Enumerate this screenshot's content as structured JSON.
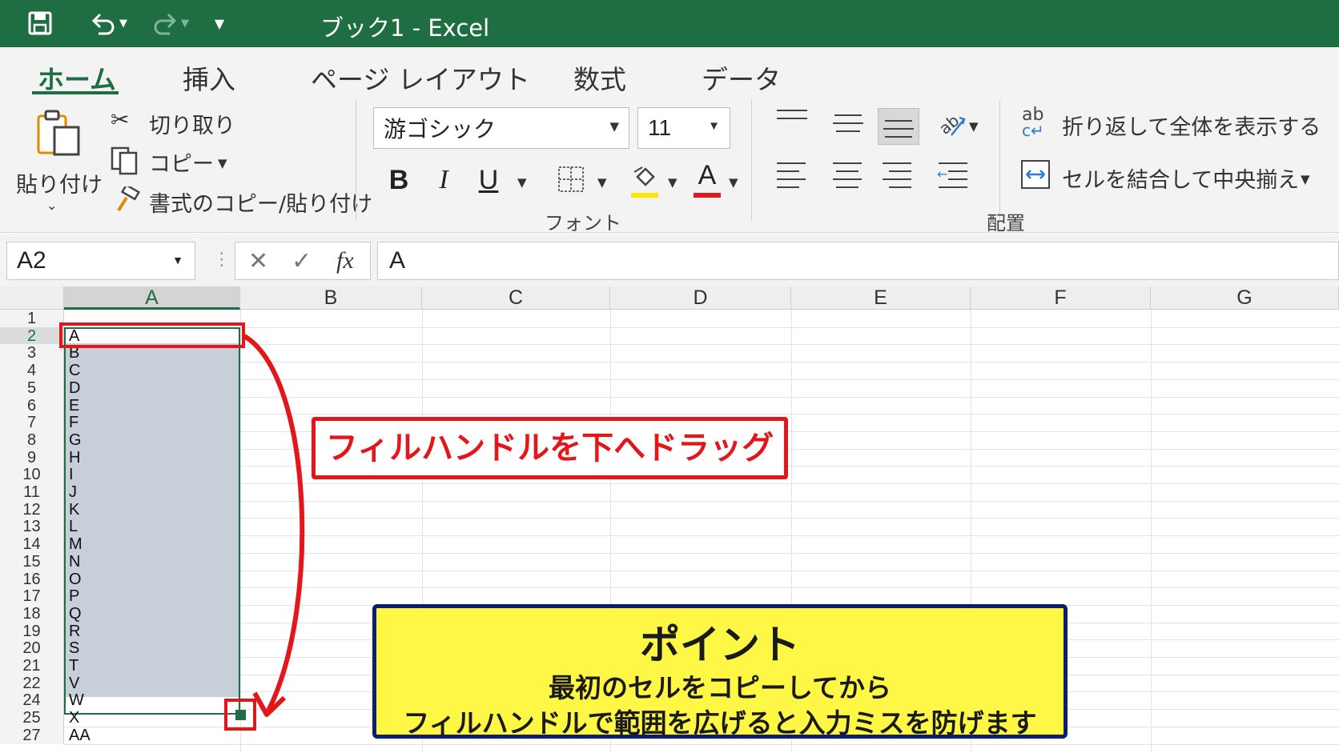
{
  "titlebar": {
    "title": "ブック1 - Excel",
    "icons": [
      "save-icon",
      "undo-icon",
      "redo-icon",
      "customize-quick-access-icon"
    ]
  },
  "ribbon": {
    "tabs": [
      "ホーム",
      "挿入",
      "ページ レイアウト",
      "数式",
      "データ"
    ],
    "active_tab": "ホーム",
    "clipboard": {
      "paste": "貼り付け",
      "cut": "切り取り",
      "copy": "コピー",
      "format_painter": "書式のコピー/貼り付け"
    },
    "font": {
      "font_name": "游ゴシック",
      "font_size": "11",
      "bold": "B",
      "italic": "I",
      "underline": "U",
      "font_color_letter": "A",
      "group_label": "フォント",
      "highlight_color": "#ffe500",
      "font_color": "#e3161a"
    },
    "alignment": {
      "wrap_text": "折り返して全体を表示する",
      "merge_center": "セルを結合して中央揃え",
      "wrap_icon_text": "ab",
      "group_label": "配置"
    }
  },
  "formula_bar": {
    "name_box": "A2",
    "cancel": "✕",
    "enter": "✓",
    "fx": "fx",
    "value": "A"
  },
  "sheet": {
    "columns": [
      "A",
      "B",
      "C",
      "D",
      "E",
      "F",
      "G"
    ],
    "selected_column": "A",
    "selected_row": "2",
    "rows": [
      {
        "num": "1",
        "a": ""
      },
      {
        "num": "2",
        "a": "A"
      },
      {
        "num": "3",
        "a": "B"
      },
      {
        "num": "4",
        "a": "C"
      },
      {
        "num": "5",
        "a": "D"
      },
      {
        "num": "6",
        "a": "E"
      },
      {
        "num": "7",
        "a": "F"
      },
      {
        "num": "8",
        "a": "G"
      },
      {
        "num": "9",
        "a": "H"
      },
      {
        "num": "10",
        "a": "I"
      },
      {
        "num": "11",
        "a": "J"
      },
      {
        "num": "12",
        "a": "K"
      },
      {
        "num": "13",
        "a": "L"
      },
      {
        "num": "14",
        "a": "M"
      },
      {
        "num": "15",
        "a": "N"
      },
      {
        "num": "16",
        "a": "O"
      },
      {
        "num": "17",
        "a": "P"
      },
      {
        "num": "18",
        "a": "Q"
      },
      {
        "num": "19",
        "a": "R"
      },
      {
        "num": "20",
        "a": "S"
      },
      {
        "num": "21",
        "a": "T"
      },
      {
        "num": "22",
        "a": "V"
      },
      {
        "num": "24",
        "a": "W"
      },
      {
        "num": "25",
        "a": "X"
      },
      {
        "num": "27",
        "a": "AA"
      }
    ]
  },
  "annotations": {
    "drag_label": "フィルハンドルを下へドラッグ",
    "point_title": "ポイント",
    "point_line1": "最初のセルをコピーしてから",
    "point_line2": "フィルハンドルで範囲を広げると入力ミスを防げます",
    "accent_red": "#e3161a",
    "callout_yellow": "#fef745",
    "callout_border": "#0d1f6b",
    "excel_green": "#1f6e43"
  }
}
